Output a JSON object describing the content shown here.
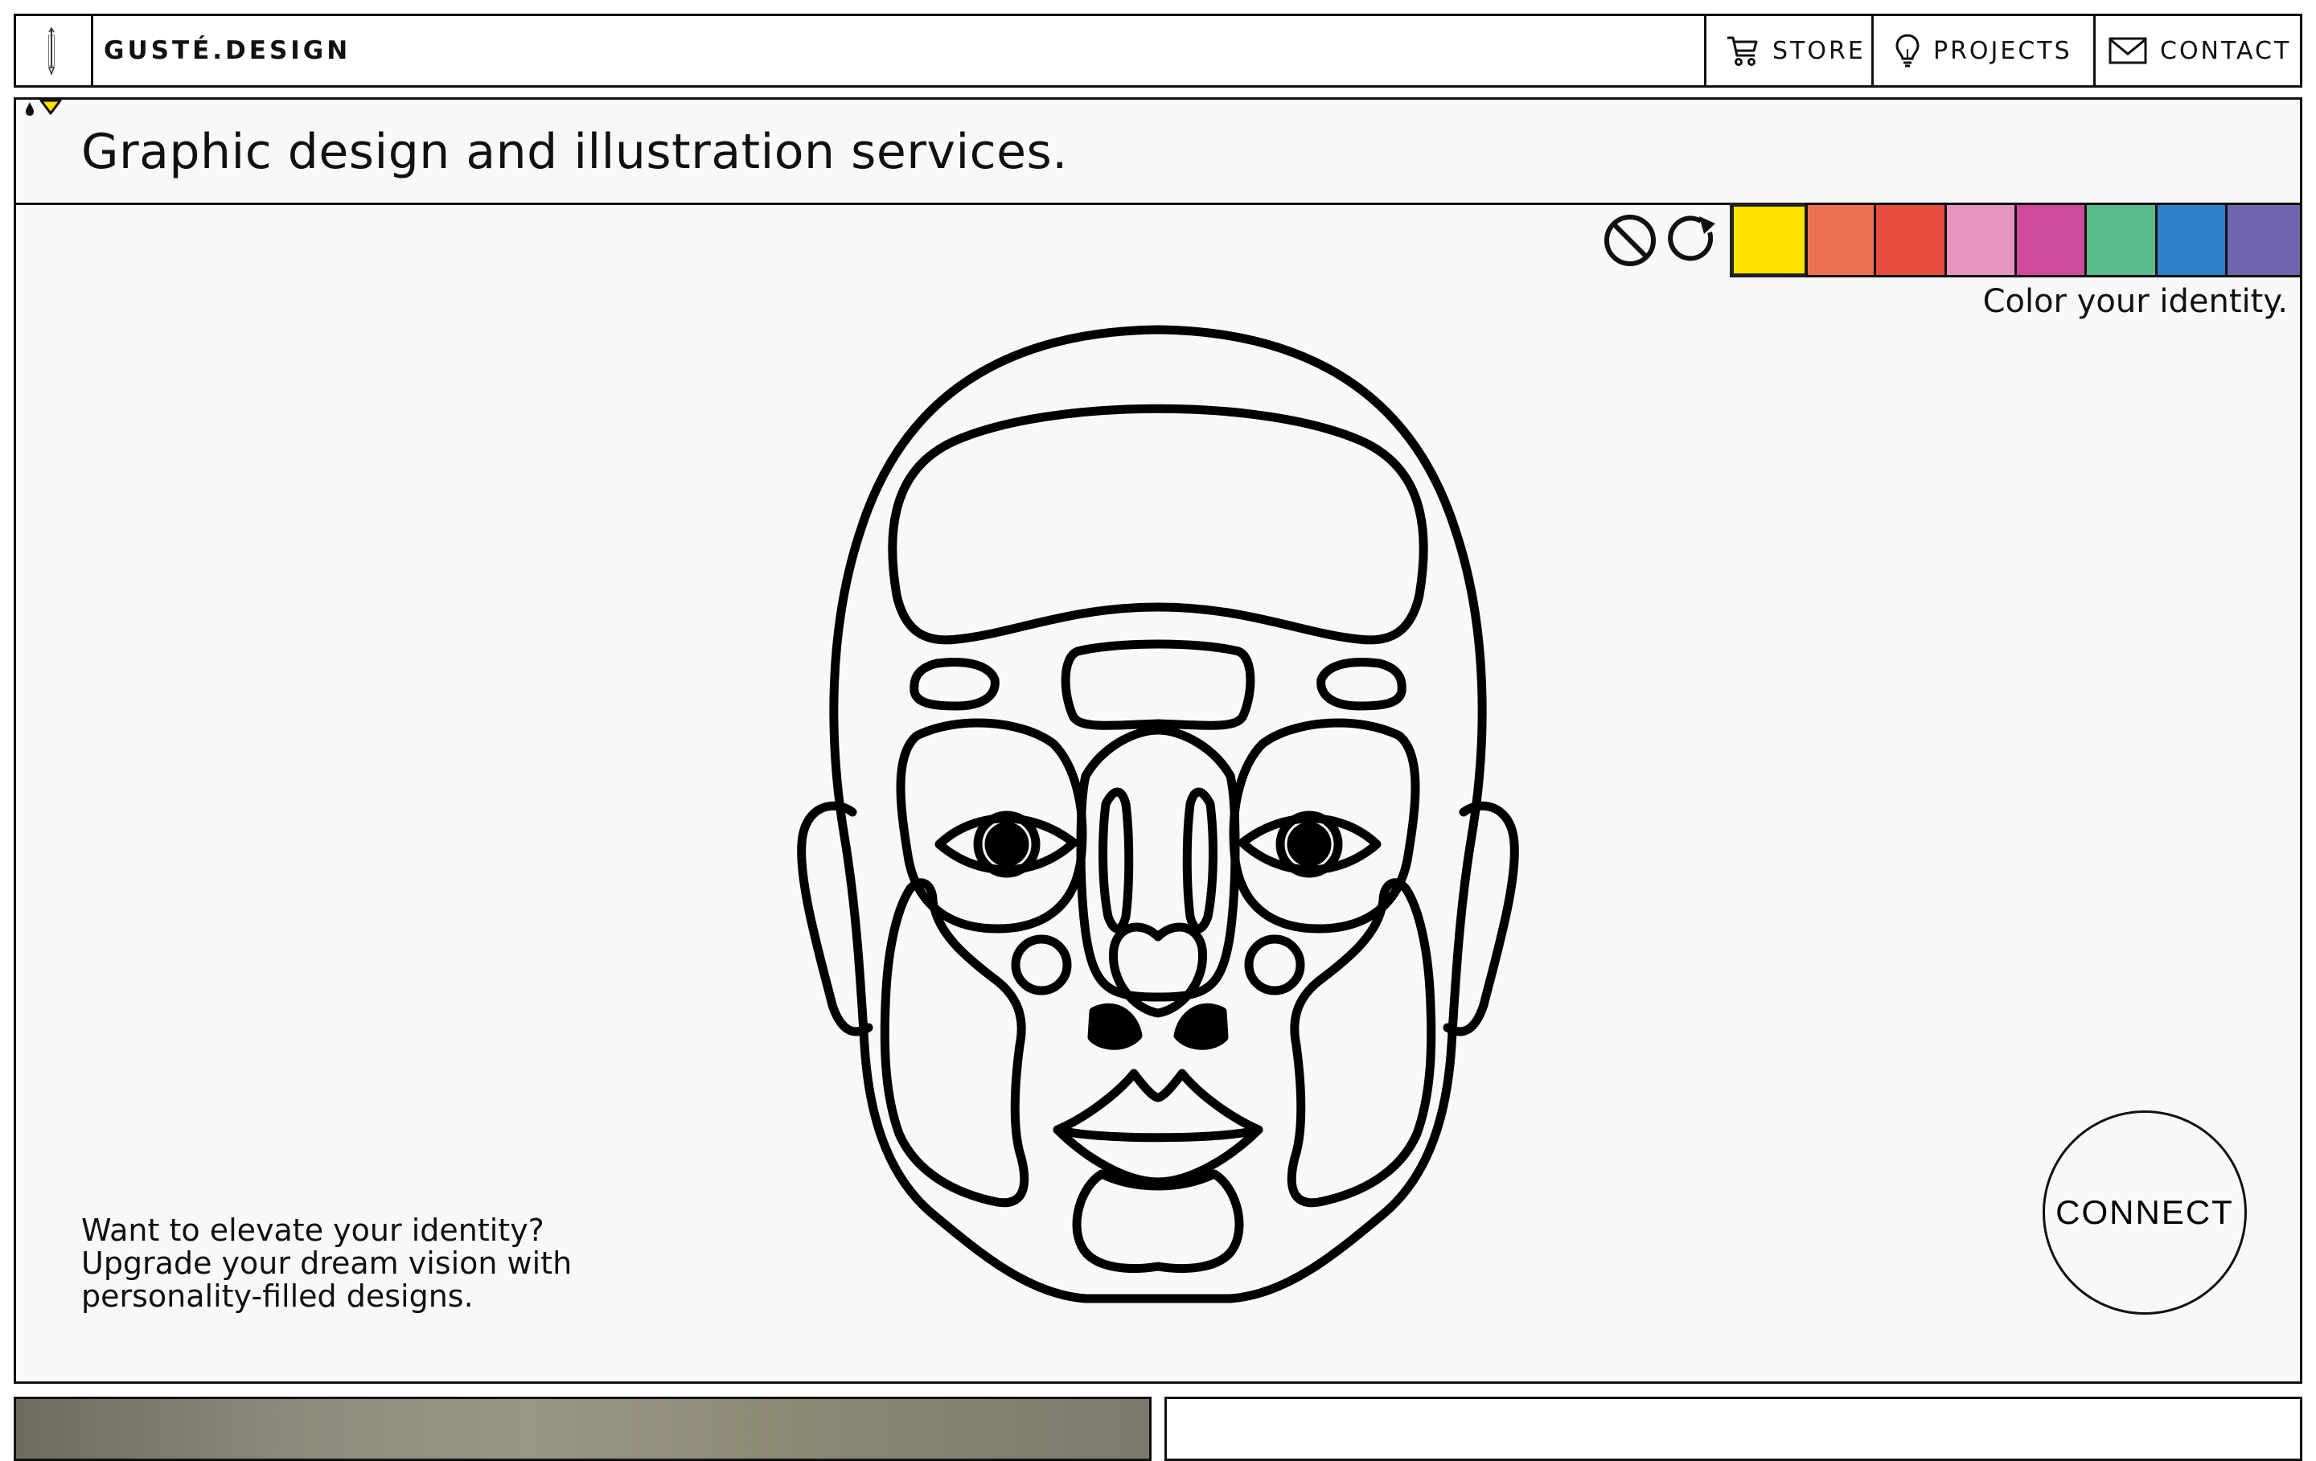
{
  "header": {
    "brand": "GUSTÉ.DESIGN",
    "logo_icon": "pencil-icon",
    "nav": [
      {
        "label": "STORE",
        "icon": "cart-icon"
      },
      {
        "label": "PROJECTS",
        "icon": "lightbulb-icon"
      },
      {
        "label": "CONTACT",
        "icon": "mail-icon"
      }
    ]
  },
  "hero": {
    "title": "Graphic design and illustration services.",
    "corner_icons": [
      "ink-drop-icon",
      "chevron-down-icon"
    ],
    "palette": {
      "tools": [
        {
          "name": "clear",
          "icon": "no-symbol-icon"
        },
        {
          "name": "reset",
          "icon": "refresh-icon"
        }
      ],
      "swatches": [
        "#FFE100",
        "#EC7152",
        "#E74C3F",
        "#E894C1",
        "#CF4A9C",
        "#5BBA8A",
        "#2D81C9",
        "#6E65AE"
      ],
      "selected": "#FFE100",
      "caption": "Color your identity."
    },
    "pitch": [
      "Want to elevate your identity?",
      "Upgrade your dream vision with",
      "personality-filled designs."
    ],
    "cta": "CONNECT"
  },
  "colors": {
    "ink": "#111111",
    "panel_bg": "#F8F8F8",
    "accent_yellow": "#FFE100"
  }
}
